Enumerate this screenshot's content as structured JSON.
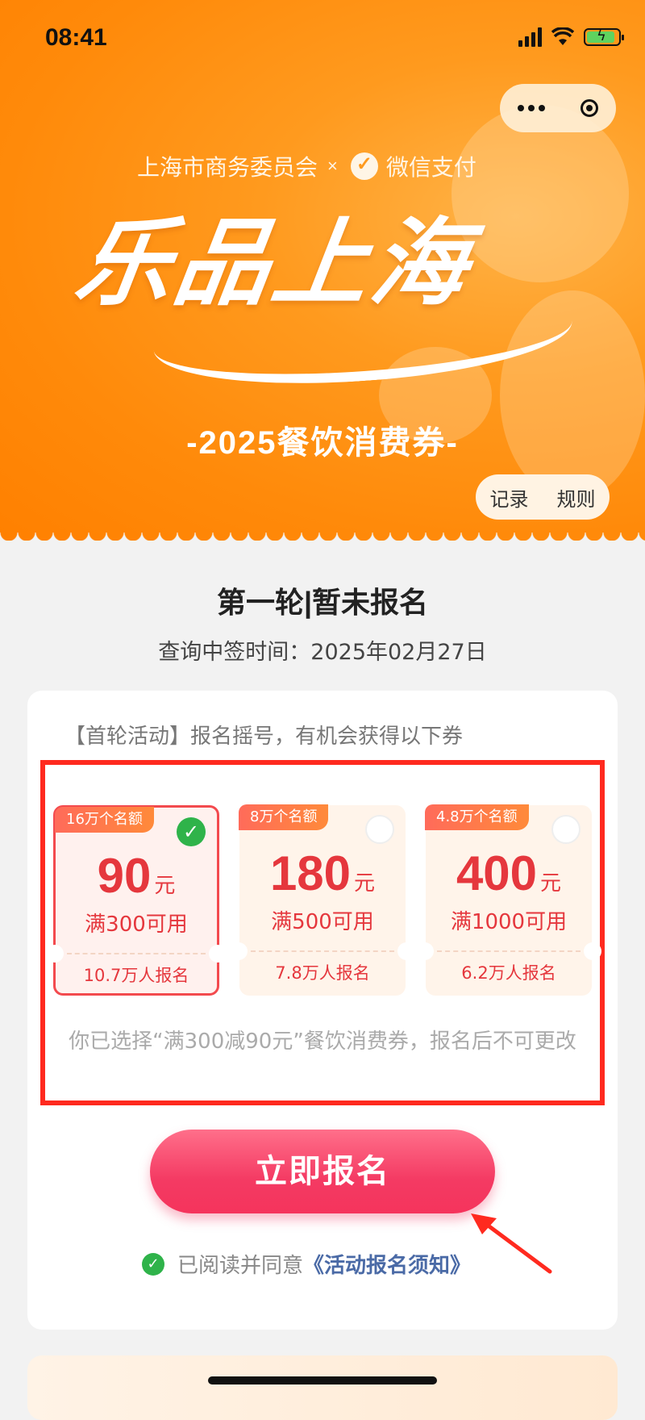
{
  "status_bar": {
    "time": "08:41"
  },
  "header": {
    "partner_left": "上海市商务委员会",
    "separator": "×",
    "partner_right": "微信支付",
    "title": "乐品上海",
    "subtitle": "-2025餐饮消费券-",
    "records_label": "记录",
    "rules_label": "规则"
  },
  "round": {
    "title": "第一轮|暂未报名",
    "query_time": "查询中签时间：2025年02月27日"
  },
  "activity": {
    "intro": "【首轮活动】报名摇号，有机会获得以下券",
    "coupons": [
      {
        "quota": "16万个名额",
        "amount": "90",
        "unit": "元",
        "condition": "满300可用",
        "enrolled": "10.7万人报名",
        "selected": true
      },
      {
        "quota": "8万个名额",
        "amount": "180",
        "unit": "元",
        "condition": "满500可用",
        "enrolled": "7.8万人报名",
        "selected": false
      },
      {
        "quota": "4.8万个名额",
        "amount": "400",
        "unit": "元",
        "condition": "满1000可用",
        "enrolled": "6.2万人报名",
        "selected": false
      }
    ],
    "selection_note": "你已选择“满300减90元”餐饮消费券，报名后不可更改"
  },
  "signup": {
    "button_label": "立即报名",
    "agree_text": "已阅读并同意",
    "agree_link": "《活动报名须知》"
  },
  "colors": {
    "banner_orange": "#ff8a0a",
    "coupon_red": "#e5373d",
    "cta_pink": "#f43a63",
    "highlight_red": "#ff2a1f",
    "check_green": "#2fb34a"
  }
}
